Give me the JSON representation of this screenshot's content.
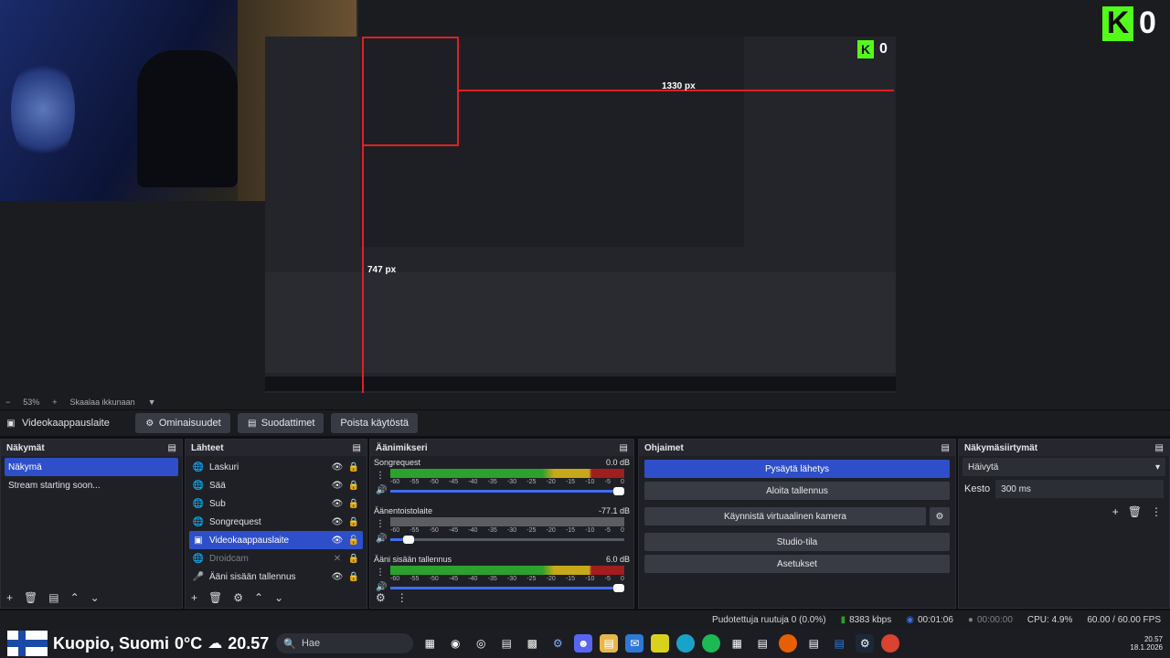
{
  "overlay": {
    "kick_logo_letter": "K",
    "kick_count": "0",
    "kick_color": "#53fc18",
    "measure_width": "1330 px",
    "measure_height": "747 px"
  },
  "scale": {
    "minus": "−",
    "zoom": "53%",
    "plus": "+",
    "fit_label": "Skaalaa ikkunaan",
    "caret": "▼"
  },
  "source_toolbar": {
    "source_name": "Videokaappauslaite",
    "properties": "Ominaisuudet",
    "filters": "Suodattimet",
    "deactivate": "Poista käytöstä"
  },
  "scenes": {
    "title": "Näkymät",
    "items": [
      {
        "label": "Näkymä",
        "selected": true
      },
      {
        "label": "Stream starting soon...",
        "selected": false
      }
    ]
  },
  "sources": {
    "title": "Lähteet",
    "items": [
      {
        "label": "Laskuri",
        "icon": "globe-icon"
      },
      {
        "label": "Sää",
        "icon": "globe-icon"
      },
      {
        "label": "Sub",
        "icon": "globe-icon"
      },
      {
        "label": "Songrequest",
        "icon": "globe-icon"
      },
      {
        "label": "Videokaappauslaite",
        "icon": "camera-icon"
      },
      {
        "label": "Droidcam",
        "icon": "globe-icon"
      },
      {
        "label": "Ääni sisään tallennus",
        "icon": "mic-icon"
      }
    ]
  },
  "mixer": {
    "title": "Äänimikseri",
    "ticks": [
      "-60",
      "-55",
      "-50",
      "-45",
      "-40",
      "-35",
      "-30",
      "-25",
      "-20",
      "-15",
      "-10",
      "-5",
      "0"
    ],
    "channels": [
      {
        "name": "Songrequest",
        "db": "0.0 dB",
        "volume": 1.0,
        "muted": false
      },
      {
        "name": "Äänentoistolaite",
        "db": "-77.1 dB",
        "volume": 0.1,
        "muted": true
      },
      {
        "name": "Ääni sisään tallennus",
        "db": "6.0 dB",
        "volume": 1.0,
        "muted": false
      }
    ]
  },
  "controls": {
    "title": "Ohjaimet",
    "stop_stream": "Pysäytä lähetys",
    "start_recording": "Aloita tallennus",
    "virtual_cam": "Käynnistä virtuaalinen kamera",
    "studio_mode": "Studio-tila",
    "settings": "Asetukset"
  },
  "transitions": {
    "title": "Näkymäsiirtymät",
    "selected": "Häivytä",
    "duration_label": "Kesto",
    "duration_value": "300 ms"
  },
  "status": {
    "dropped": "Pudotettuja ruutuja 0 (0.0%)",
    "bitrate": "8383 kbps",
    "stream_time": "00:01:06",
    "rec_time": "00:00:00",
    "cpu": "CPU: 4.9%",
    "fps": "60.00 / 60.00 FPS"
  },
  "taskbar": {
    "location": "Kuopio, Suomi",
    "temp": "0°C",
    "clock_overlay": "20.57",
    "search_placeholder": "Hae",
    "time": "20.57",
    "date": "18.1.2026"
  }
}
